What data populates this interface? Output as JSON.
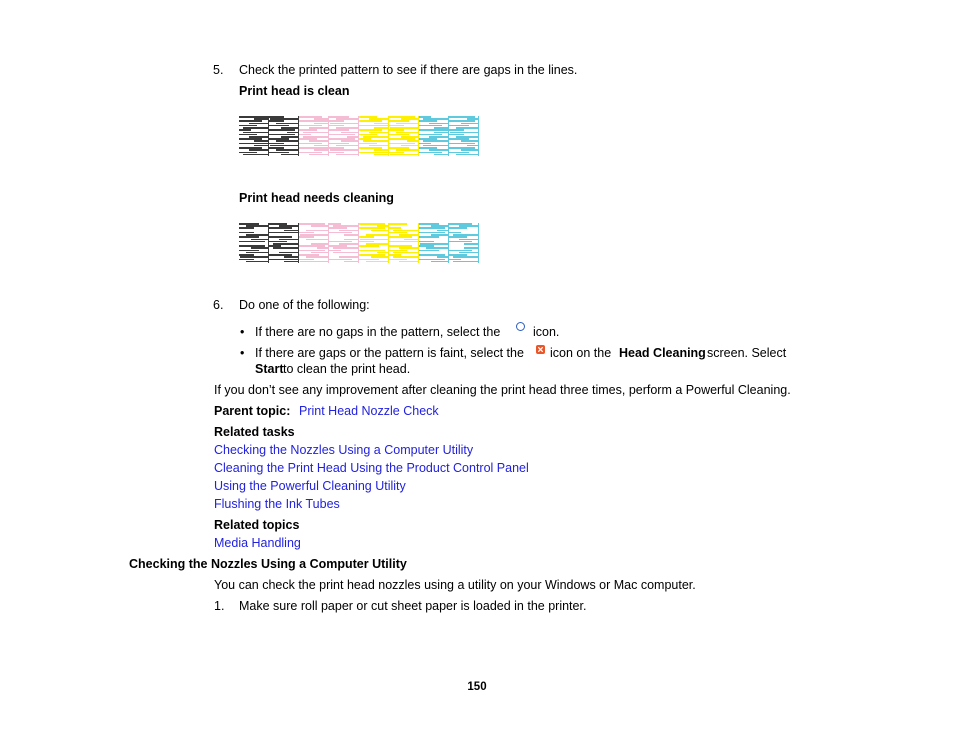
{
  "document": {
    "page_number": "150",
    "steps": [
      {
        "marker": "5.",
        "text": "Check the printed pattern to see if there are gaps in the lines."
      },
      {
        "marker": "6.",
        "text": "Do one of the following:"
      }
    ],
    "pattern_captions": {
      "clean": "Print head is clean",
      "needs_cleaning": "Print head needs cleaning"
    },
    "bullets": [
      {
        "before_icon": "If there are no gaps in the pattern, select the",
        "icon": "ring-icon",
        "after_icon": "icon."
      },
      {
        "before_icon": "If there are gaps or the pattern is faint, select the",
        "icon": "x-circle-icon",
        "after_icon_1": "icon on the",
        "bold_1": "Head Cleaning",
        "after_icon_2": "screen. Select",
        "bold_2": "Start",
        "after_icon_3": "to clean the print head."
      }
    ],
    "note": "If you don’t see any improvement after cleaning the print head three times, perform a Powerful Cleaning.",
    "parent_topic": {
      "label": "Parent topic:",
      "link": "Print Head Nozzle Check"
    },
    "related_tasks": {
      "heading": "Related tasks",
      "links": [
        "Checking the Nozzles Using a Computer Utility",
        "Cleaning the Print Head Using the Product Control Panel",
        "Using the Powerful Cleaning Utility",
        "Flushing the Ink Tubes"
      ]
    },
    "related_topics": {
      "heading": "Related topics",
      "links": [
        "Media Handling"
      ]
    },
    "section": {
      "heading": "Checking the Nozzles Using a Computer Utility",
      "intro": "You can check the print head nozzles using a utility on your Windows or Mac computer.",
      "steps": [
        {
          "marker": "1.",
          "text": "Make sure roll paper or cut sheet paper is loaded in the printer."
        }
      ]
    }
  },
  "nozzle_patterns": {
    "colors": {
      "black": "#3a3a3a",
      "magenta": "#f4bdd4",
      "yellow": "#fdf000",
      "cyan": "#5fc9dd"
    },
    "column_order": [
      "black",
      "black",
      "magenta",
      "magenta",
      "yellow",
      "yellow",
      "cyan",
      "cyan"
    ],
    "clean": {
      "caption": "Print head is clean",
      "rows": 18,
      "gaps": []
    },
    "needs_cleaning": {
      "caption": "Print head needs cleaning",
      "rows": 18,
      "gaps": [
        [
          0,
          3
        ],
        [
          0,
          9
        ],
        [
          1,
          5
        ],
        [
          1,
          12
        ],
        [
          2,
          2
        ],
        [
          2,
          8
        ],
        [
          3,
          6
        ],
        [
          3,
          14
        ],
        [
          4,
          4
        ],
        [
          4,
          11
        ],
        [
          5,
          1
        ],
        [
          5,
          9
        ],
        [
          6,
          7
        ],
        [
          6,
          13
        ],
        [
          7,
          3
        ],
        [
          7,
          10
        ]
      ]
    }
  },
  "colors": {
    "link": "#2222dd",
    "text": "#000000",
    "icon_ring": "#2b5fc4",
    "icon_alert": "#e8562a"
  }
}
